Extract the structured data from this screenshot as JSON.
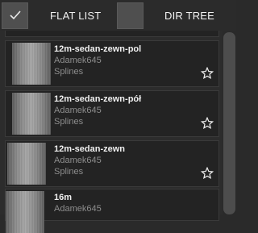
{
  "toolbar": {
    "flat_list_label": "FLAT LIST",
    "dir_tree_label": "DIR TREE",
    "flat_list_checked": true,
    "dir_tree_checked": false
  },
  "items": [
    {
      "name": "12m-sedan-zewn-pol",
      "author": "Adamek645",
      "category": "Splines"
    },
    {
      "name": "12m-sedan-zewn-pół",
      "author": "Adamek645",
      "category": "Splines"
    },
    {
      "name": "12m-sedan-zewn",
      "author": "Adamek645",
      "category": "Splines"
    },
    {
      "name": "16m",
      "author": "Adamek645",
      "category": ""
    }
  ],
  "colors": {
    "background": "#2a2a2a",
    "row": "#232323",
    "accent_text": "#f0f0f0",
    "muted_text": "#8d8d8d"
  }
}
